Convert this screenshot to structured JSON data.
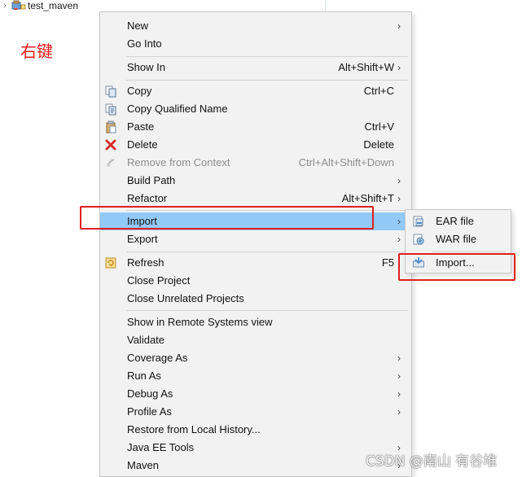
{
  "background": {
    "project_label": "test_maven",
    "annotation_text": "右键"
  },
  "context_menu": {
    "items": {
      "new": {
        "label": "New"
      },
      "go_into": {
        "label": "Go Into"
      },
      "show_in": {
        "label": "Show In",
        "shortcut": "Alt+Shift+W"
      },
      "copy": {
        "label": "Copy",
        "shortcut": "Ctrl+C"
      },
      "copy_qualified_name": {
        "label": "Copy Qualified Name"
      },
      "paste": {
        "label": "Paste",
        "shortcut": "Ctrl+V"
      },
      "delete": {
        "label": "Delete",
        "shortcut": "Delete"
      },
      "remove_from_context": {
        "label": "Remove from Context",
        "shortcut": "Ctrl+Alt+Shift+Down"
      },
      "build_path": {
        "label": "Build Path"
      },
      "refactor": {
        "label": "Refactor",
        "shortcut": "Alt+Shift+T"
      },
      "import": {
        "label": "Import"
      },
      "export": {
        "label": "Export"
      },
      "refresh": {
        "label": "Refresh",
        "shortcut": "F5"
      },
      "close_project": {
        "label": "Close Project"
      },
      "close_unrelated_projects": {
        "label": "Close Unrelated Projects"
      },
      "show_in_remote_systems_view": {
        "label": "Show in Remote Systems view"
      },
      "validate": {
        "label": "Validate"
      },
      "coverage_as": {
        "label": "Coverage As"
      },
      "run_as": {
        "label": "Run As"
      },
      "debug_as": {
        "label": "Debug As"
      },
      "profile_as": {
        "label": "Profile As"
      },
      "restore_from_local_history": {
        "label": "Restore from Local History..."
      },
      "java_ee_tools": {
        "label": "Java EE Tools"
      },
      "maven": {
        "label": "Maven"
      }
    }
  },
  "import_submenu": {
    "ear_file": {
      "label": "EAR file"
    },
    "war_file": {
      "label": "WAR file"
    },
    "import_dialog": {
      "label": "Import..."
    }
  },
  "watermark": {
    "text": "CSDN @南山 有谷堆"
  },
  "colors": {
    "menu_background": "#f2f2f2",
    "highlight": "#91c9f7",
    "annotation_red": "#e01e1e",
    "disabled_text": "#8d8d8d"
  },
  "icons": {
    "tree": "java-project-icon",
    "copy": "copy-icon",
    "copy_qualified_name": "copy-qualified-name-icon",
    "paste": "paste-icon",
    "delete": "delete-icon",
    "remove_from_context": "remove-context-icon",
    "refresh": "refresh-icon",
    "ear_file": "ear-file-icon",
    "war_file": "war-file-icon",
    "import_dialog": "import-wizard-icon"
  }
}
